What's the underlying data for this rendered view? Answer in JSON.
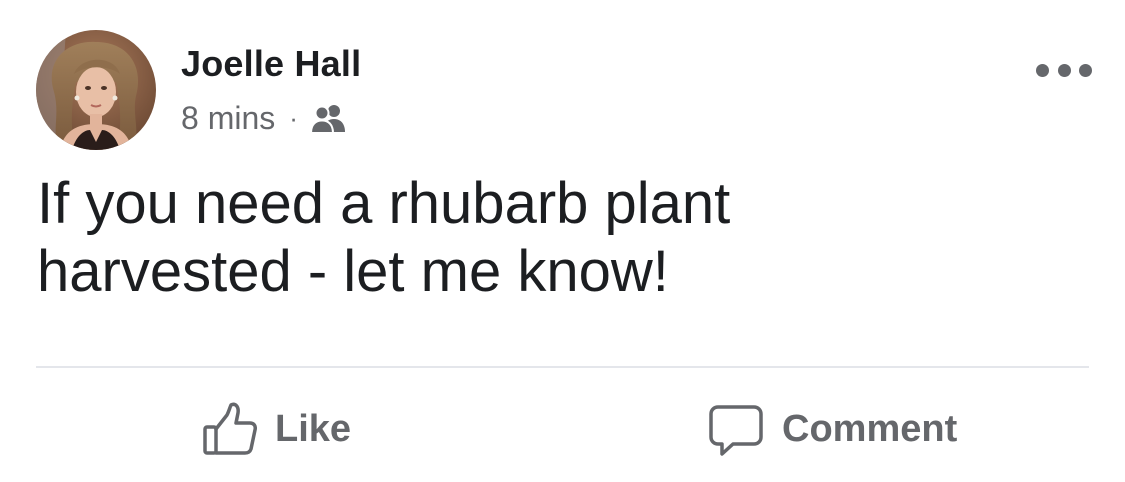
{
  "post": {
    "author": {
      "name": "Joelle Hall",
      "avatar_icon": "profile-photo"
    },
    "timestamp": "8 mins",
    "separator": "·",
    "audience_icon": "friends-icon",
    "more_icon": "more-horizontal-icon",
    "text": "If you need a rhubarb plant\nharvested - let me know!"
  },
  "actions": {
    "like": {
      "label": "Like",
      "icon": "thumbs-up-icon"
    },
    "comment": {
      "label": "Comment",
      "icon": "comment-bubble-icon"
    }
  },
  "colors": {
    "primary_text": "#1c1e21",
    "secondary_text": "#65676b",
    "divider": "#e4e6eb"
  }
}
